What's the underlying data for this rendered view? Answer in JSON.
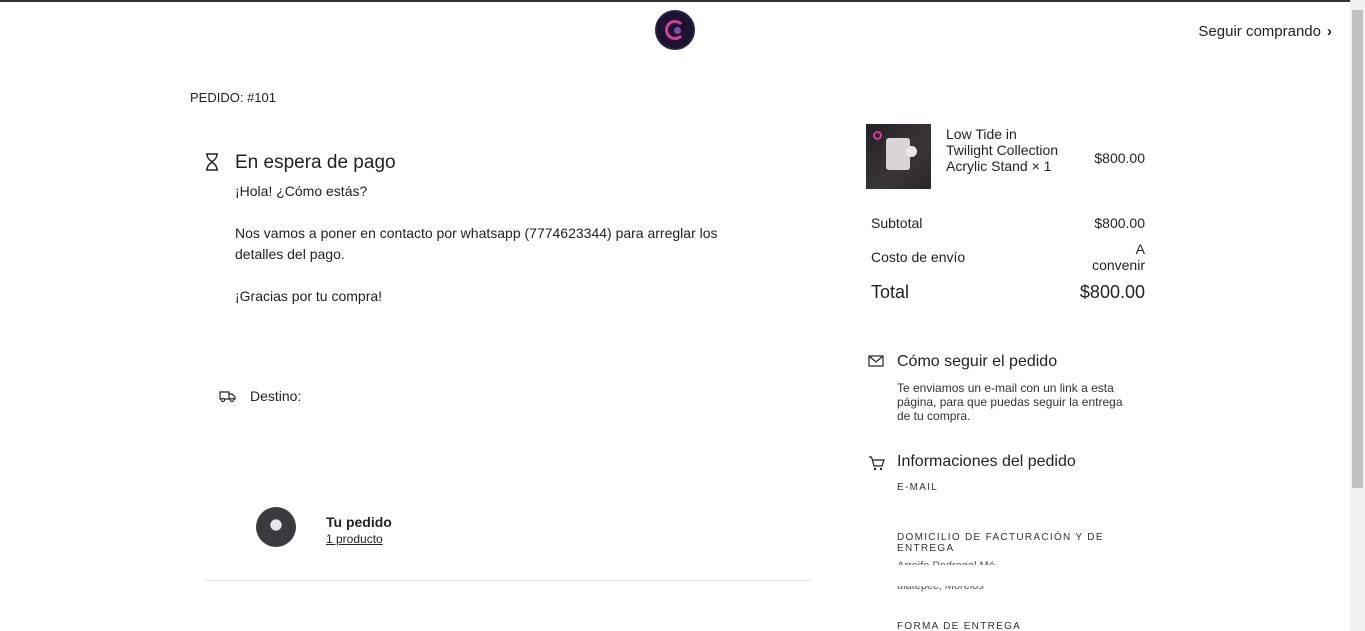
{
  "header": {
    "logo_name": "store-logo",
    "continue_label": "Seguir comprando",
    "continue_icon": "chevron-right-icon"
  },
  "order": {
    "id_label": "PEDIDO: #101"
  },
  "status": {
    "icon": "hourglass-icon",
    "title": "En espera de pago",
    "greeting": "¡Hola! ¿Cómo estás?",
    "message": "Nos vamos a poner en contacto por whatsapp (7774623344) para arreglar los detalles del pago.",
    "thanks": "¡Gracias por tu compra!"
  },
  "destination": {
    "icon": "truck-icon",
    "label": "Destino:"
  },
  "your_order": {
    "title": "Tu pedido",
    "link": "1 producto"
  },
  "summary": {
    "product": {
      "name": "Low Tide in Twilight Collection Acrylic Stand × 1",
      "price": "$800.00"
    },
    "subtotal_label": "Subtotal",
    "subtotal_value": "$800.00",
    "shipping_label": "Costo de envío",
    "shipping_value": "A convenir",
    "total_label": "Total",
    "total_value": "$800.00"
  },
  "tracking": {
    "icon": "mail-icon",
    "title": "Cómo seguir el pedido",
    "text": "Te enviamos un e-mail con un link a esta página, para que puedas seguir la entrega de tu compra."
  },
  "order_info": {
    "icon": "cart-icon",
    "title": "Informaciones del pedido",
    "email_label": "E-MAIL",
    "address_label": "DOMICILIO DE FACTURACIÓN Y DE ENTREGA",
    "address_partial_1": "Arreife Pedregal Mé...",
    "address_partial_2": "ulatepec, Morelos",
    "delivery_label": "FORMA DE ENTREGA"
  }
}
